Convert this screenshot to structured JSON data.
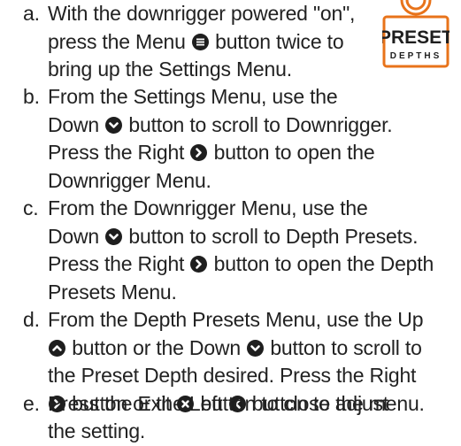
{
  "badge": {
    "line1": "PRESET",
    "line2": "DEPTHS"
  },
  "steps": [
    {
      "mark": "a.",
      "lines": [
        [
          "With the downrigger powered \"on\","
        ],
        [
          "press the Menu ",
          "menu-icon",
          " button twice to"
        ],
        [
          "bring up the Settings Menu."
        ]
      ]
    },
    {
      "mark": "b.",
      "lines": [
        [
          "From the Settings Menu, use the"
        ],
        [
          "Down ",
          "down-icon",
          " button to scroll to Downrigger."
        ],
        [
          "Press the Right ",
          "right-icon",
          " button to open the"
        ],
        [
          "Downrigger Menu."
        ]
      ]
    },
    {
      "mark": "c.",
      "lines": [
        [
          "From the Downrigger Menu, use the"
        ],
        [
          "Down ",
          "down-icon",
          " button to scroll to Depth Presets."
        ],
        [
          "Press the Right ",
          "right-icon",
          " button to open the Depth"
        ],
        [
          "Presets Menu."
        ]
      ]
    },
    {
      "mark": "d.",
      "lines": [
        [
          "From the Depth Presets Menu, use the Up"
        ],
        [
          "up-icon",
          " button or the Down ",
          "down-icon",
          " button to scroll to"
        ],
        [
          "the Preset Depth desired. Press the Right"
        ],
        [
          "right-icon",
          " button or the Left ",
          "left-icon",
          " button to adjust"
        ],
        [
          "the setting."
        ]
      ]
    },
    {
      "mark": "e.",
      "lines": [
        [
          "Press the Exit ",
          "exit-icon",
          " button to close the menu."
        ]
      ]
    }
  ],
  "colors": {
    "text": "#222222",
    "icon": "#1e1e1e",
    "accent": "#e8731a"
  }
}
